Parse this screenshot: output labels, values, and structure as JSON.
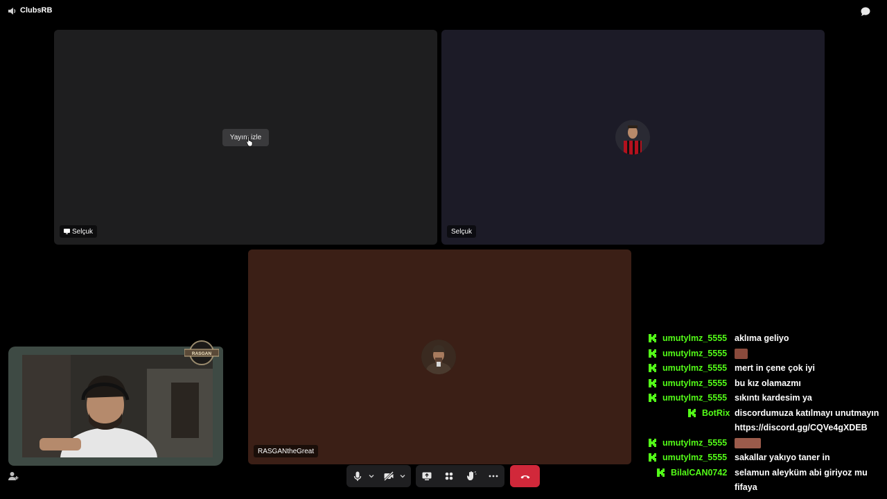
{
  "app": {
    "title": "ClubsRB"
  },
  "tiles": {
    "screen_share": {
      "watch_label": "Yayını izle",
      "name": "Selçuk"
    },
    "participant_2": {
      "name": "Selçuk"
    },
    "participant_3": {
      "name": "RASGANtheGreat"
    }
  },
  "webcam": {
    "logo_text": "RASGAN"
  },
  "chat": {
    "messages": [
      {
        "user": "umutylmz_5555",
        "text": "aklıma geliyo"
      },
      {
        "user": "umutylmz_5555",
        "text": "",
        "emote": "single"
      },
      {
        "user": "umutylmz_5555",
        "text": "mert in çene çok iyi"
      },
      {
        "user": "umutylmz_5555",
        "text": "bu kız olamazmı"
      },
      {
        "user": "umutylmz_5555",
        "text": "sıkıntı kardesim ya"
      },
      {
        "user": "BotRix",
        "text": "discordumuza katılmayı unutmayın"
      },
      {
        "user": "",
        "text": "https://discord.gg/CQVe4gXDEB"
      },
      {
        "user": "umutylmz_5555",
        "text": "",
        "emote": "wide"
      },
      {
        "user": "umutylmz_5555",
        "text": "sakallar yakıyo taner in"
      },
      {
        "user": "BilalCAN0742",
        "text": "selamun aleyküm abi giriyoz mu"
      },
      {
        "user": "",
        "text": "fifaya"
      }
    ]
  },
  "colors": {
    "kick_green": "#53fc18",
    "leave_red": "#d1283a"
  },
  "icons": [
    "speaker-icon",
    "chat-bubble-icon",
    "microphone-icon",
    "camera-off-icon",
    "share-screen-icon",
    "activities-icon",
    "raise-hand-icon",
    "more-icon",
    "hangup-icon",
    "add-user-icon"
  ]
}
